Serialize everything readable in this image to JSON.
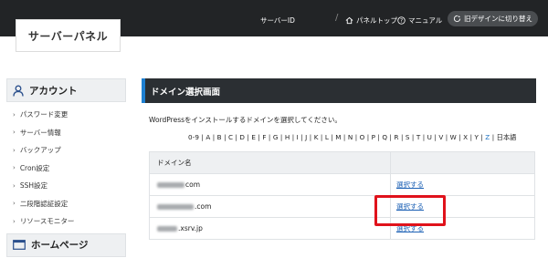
{
  "header": {
    "logo": "サーバーパネル",
    "server_id_label": "サーバーID",
    "nav_panel_top": "パネルトップ",
    "nav_manual": "マニュアル",
    "old_design_button": "旧デザインに切り替え"
  },
  "sidebar": {
    "account_heading": "アカウント",
    "account_items": [
      "パスワード変更",
      "サーバー情報",
      "バックアップ",
      "Cron設定",
      "SSH設定",
      "二段階認証設定",
      "リソースモニター"
    ],
    "homepage_heading": "ホームページ"
  },
  "main": {
    "title": "ドメイン選択画面",
    "instruction": "WordPressをインストールするドメインを選択してください。",
    "alpha_index": [
      "0-9",
      "A",
      "B",
      "C",
      "D",
      "E",
      "F",
      "G",
      "H",
      "I",
      "J",
      "K",
      "L",
      "M",
      "N",
      "O",
      "P",
      "Q",
      "R",
      "S",
      "T",
      "U",
      "V",
      "W",
      "X",
      "Y",
      "Z",
      "日本語"
    ],
    "alpha_active": "Z",
    "table": {
      "col_domain": "ドメイン名",
      "rows": [
        {
          "domain_suffix": "com",
          "action": "選択する"
        },
        {
          "domain_suffix": ".com",
          "action": "選択する"
        },
        {
          "domain_suffix": ".xsrv.jp",
          "action": "選択する"
        }
      ]
    }
  },
  "colors": {
    "header_bg": "#222426",
    "accent": "#1e7fd0",
    "highlight": "#e0121b",
    "link": "#1a5fb4"
  }
}
